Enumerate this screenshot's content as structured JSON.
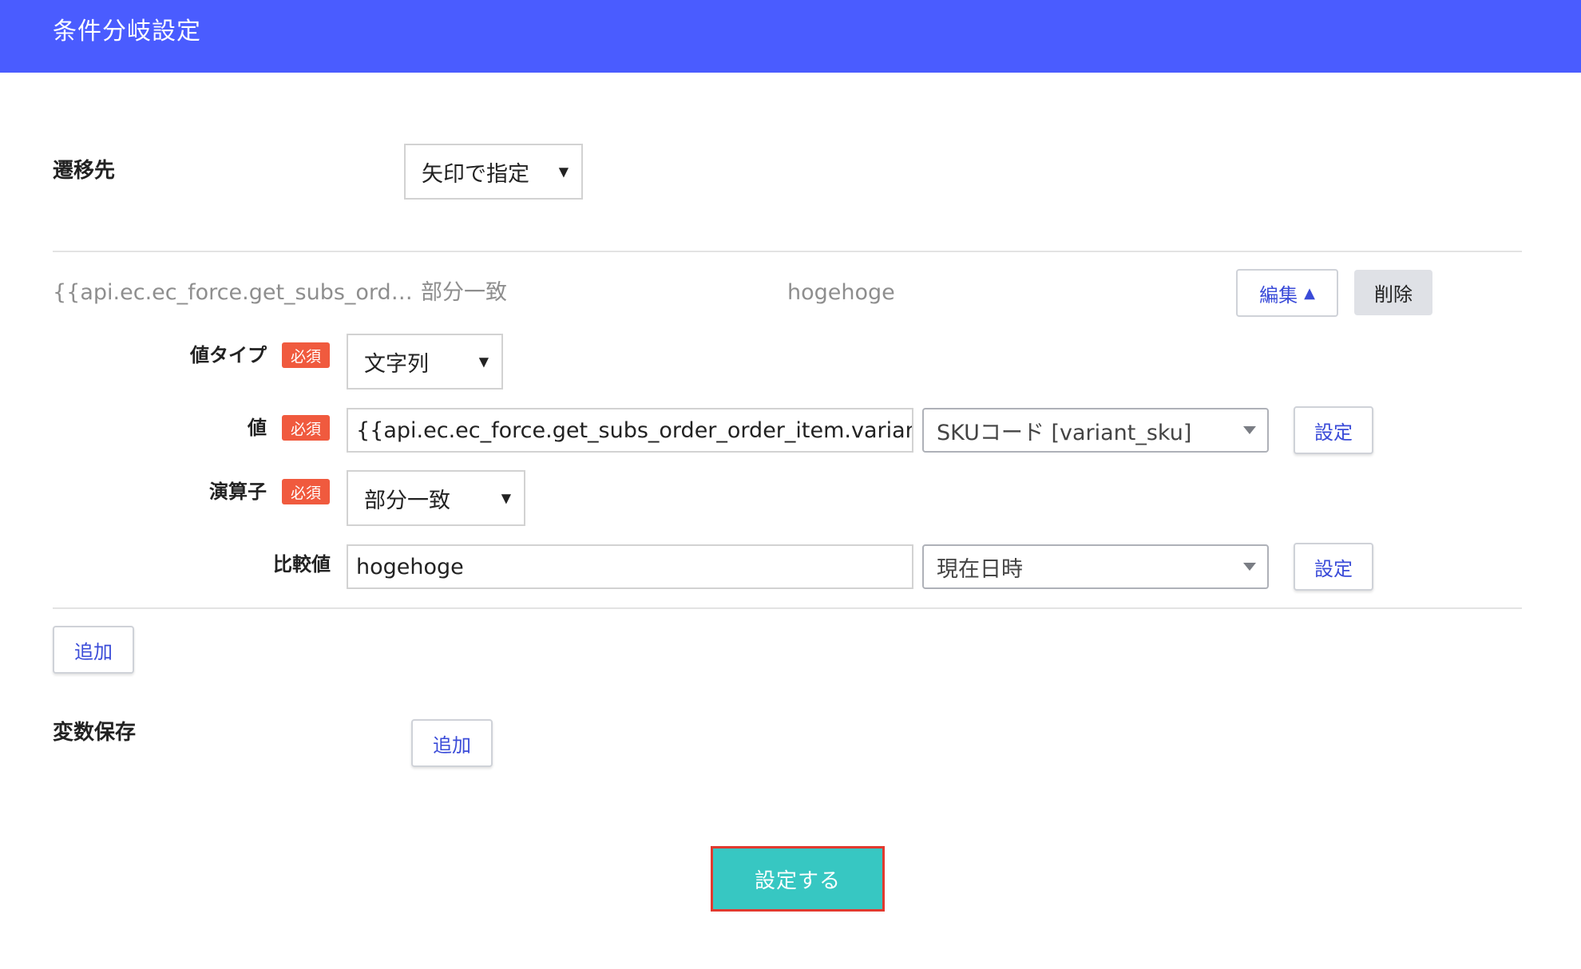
{
  "header": {
    "title": "条件分岐設定"
  },
  "transition": {
    "label": "遷移先",
    "select_value": "矢印で指定"
  },
  "condition": {
    "summary_value": "{{api.ec.ec_force.get_subs_ord…",
    "summary_operator": "部分一致",
    "summary_compare": "hogehoge",
    "edit_label": "編集",
    "delete_label": "削除",
    "fields": {
      "value_type": {
        "label": "値タイプ",
        "badge": "必須",
        "select_value": "文字列"
      },
      "value": {
        "label": "値",
        "badge": "必須",
        "input_value": "{{api.ec.ec_force.get_subs_order_order_item.variant_sku}}",
        "combo_value": "SKUコード [variant_sku]",
        "set_label": "設定"
      },
      "operator": {
        "label": "演算子",
        "badge": "必須",
        "select_value": "部分一致"
      },
      "compare": {
        "label": "比較値",
        "input_value": "hogehoge",
        "combo_value": "現在日時",
        "set_label": "設定"
      }
    }
  },
  "add_condition_label": "追加",
  "variable_save": {
    "label": "変数保存",
    "add_label": "追加"
  },
  "submit_label": "設定する",
  "colors": {
    "header_bg": "#4a5cff",
    "badge_required": "#f05a3e",
    "submit_bg": "#37c7c2",
    "submit_highlight": "#e13a2f",
    "link_blue": "#3a4bd8"
  }
}
